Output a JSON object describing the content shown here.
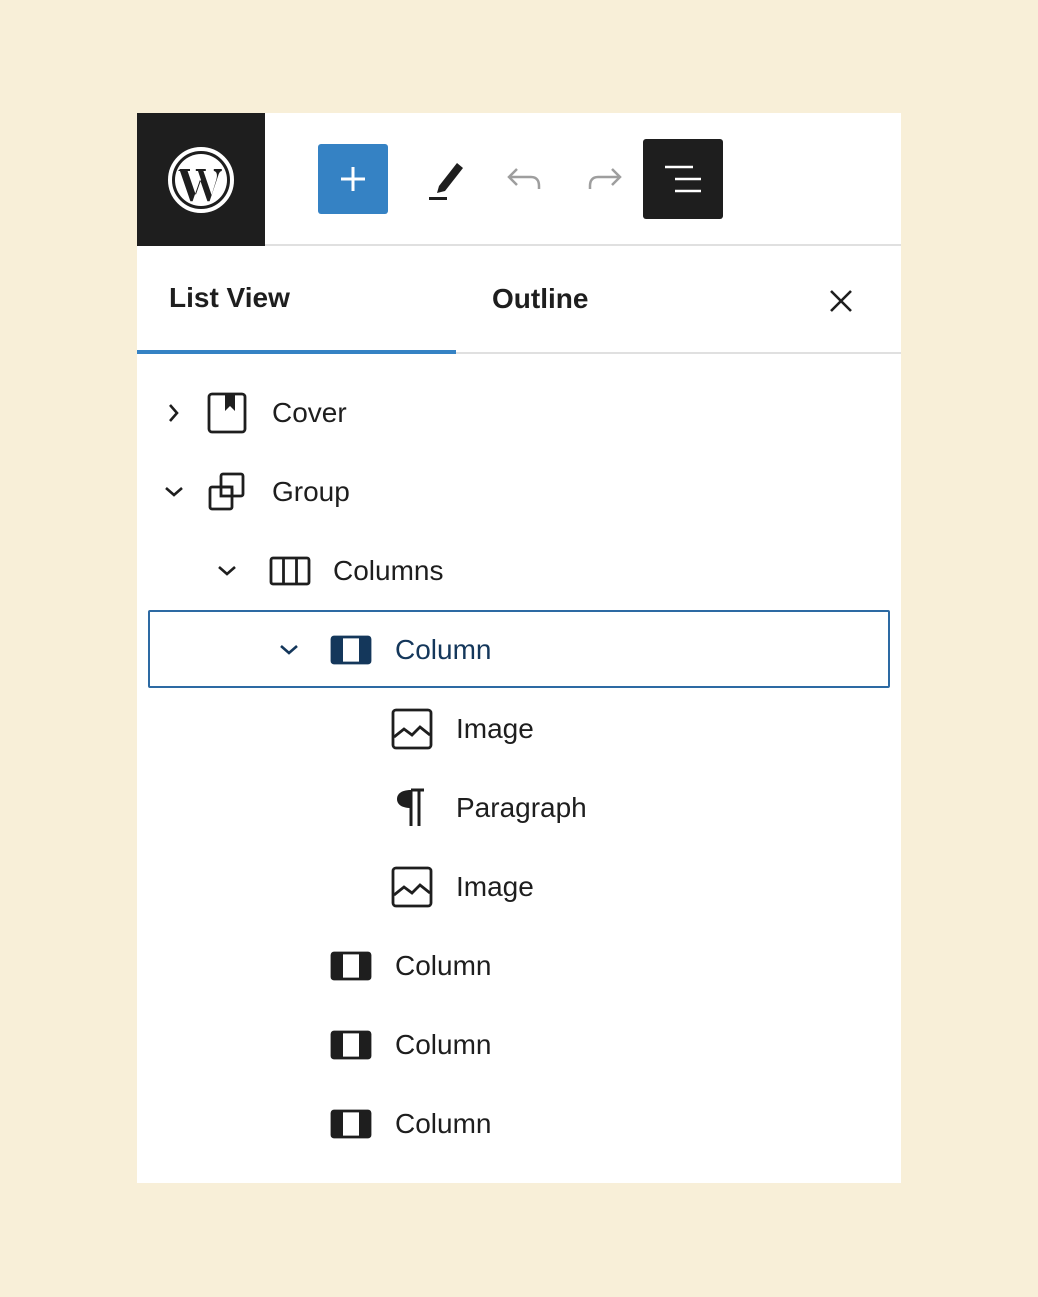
{
  "colors": {
    "page_background": "#f8efd8",
    "panel_background": "#ffffff",
    "dark": "#1e1e1e",
    "accent": "#3582c4",
    "selected_text": "#14375b"
  },
  "toolbar": {
    "logo_icon": "wordpress-logo",
    "add_icon": "plus-icon",
    "edit_icon": "pencil-icon",
    "undo_icon": "undo-icon",
    "redo_icon": "redo-icon",
    "list_view_icon": "list-view-icon"
  },
  "tabs": {
    "list_view": "List View",
    "outline": "Outline",
    "active": "List View",
    "close_icon": "close-icon"
  },
  "tree": [
    {
      "label": "Cover",
      "icon": "cover-icon",
      "expander": "chevron-right",
      "level": 0
    },
    {
      "label": "Group",
      "icon": "group-icon",
      "expander": "chevron-down",
      "level": 0
    },
    {
      "label": "Columns",
      "icon": "columns-icon",
      "expander": "chevron-down",
      "level": 1
    },
    {
      "label": "Column",
      "icon": "column-icon",
      "expander": "chevron-down",
      "level": 2,
      "selected": true
    },
    {
      "label": "Image",
      "icon": "image-icon",
      "expander": "",
      "level": 3
    },
    {
      "label": "Paragraph",
      "icon": "paragraph-icon",
      "expander": "",
      "level": 3
    },
    {
      "label": "Image",
      "icon": "image-icon",
      "expander": "",
      "level": 3
    },
    {
      "label": "Column",
      "icon": "column-icon",
      "expander": "",
      "level": 2
    },
    {
      "label": "Column",
      "icon": "column-icon",
      "expander": "",
      "level": 2
    },
    {
      "label": "Column",
      "icon": "column-icon",
      "expander": "",
      "level": 2
    }
  ]
}
